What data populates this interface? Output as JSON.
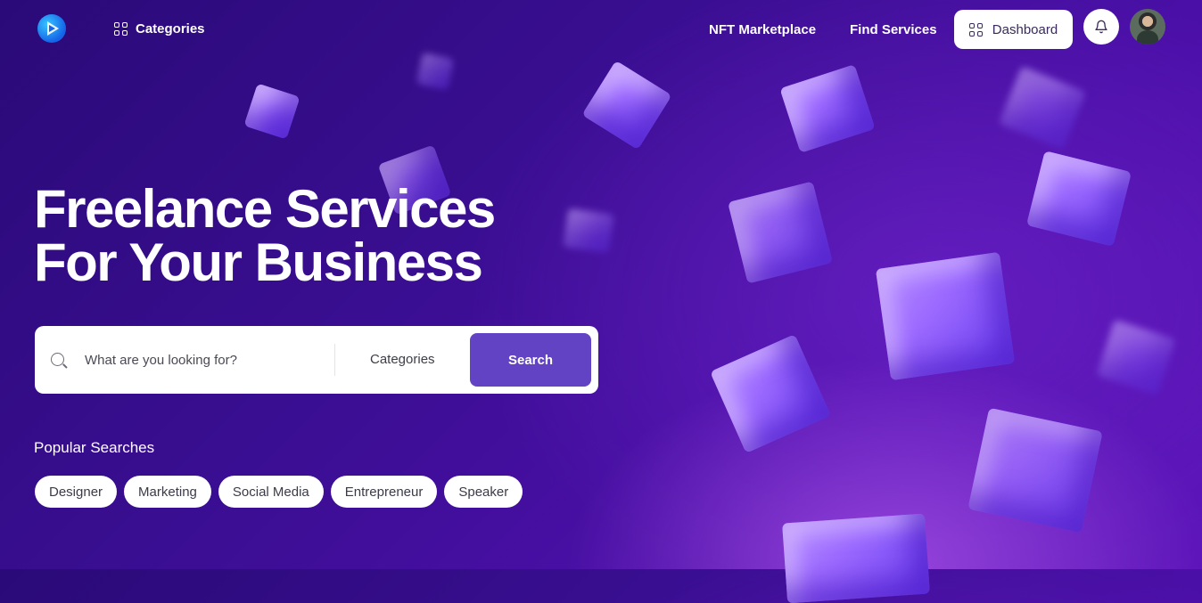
{
  "header": {
    "categories_label": "Categories",
    "nav": [
      {
        "label": "NFT Marketplace"
      },
      {
        "label": "Find Services"
      }
    ],
    "dashboard_label": "Dashboard"
  },
  "hero": {
    "title_line1": "Freelance Services",
    "title_line2": "For Your Business"
  },
  "search": {
    "placeholder": "What are you looking for?",
    "category_label": "Categories",
    "button_label": "Search"
  },
  "popular": {
    "label": "Popular Searches",
    "tags": [
      "Designer",
      "Marketing",
      "Social Media",
      "Entrepreneur",
      "Speaker"
    ]
  },
  "colors": {
    "background": "#3a0e92",
    "accent_button": "#6243c4",
    "cube": "#9d6bff"
  }
}
